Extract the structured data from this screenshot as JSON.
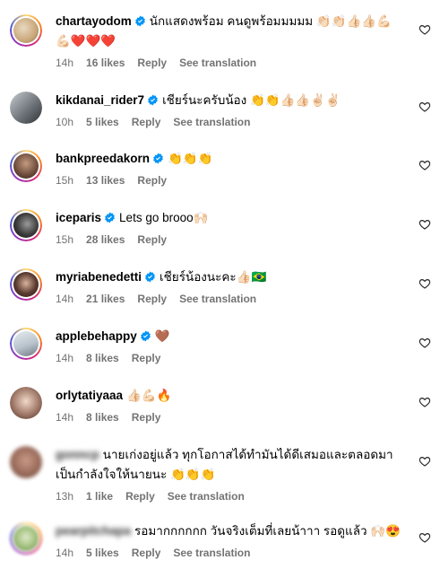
{
  "comments": [
    {
      "username": "chartayodom",
      "verified": true,
      "text": "นักแสดงพร้อม คนดูพร้อมมมมม 👏🏻👏🏻👍🏻👍🏻💪🏻",
      "text2": "💪🏻❤️❤️❤️",
      "time": "14h",
      "likes": "16 likes",
      "reply": "Reply",
      "translate": "See translation",
      "avatar_color": "#c9a77a"
    },
    {
      "username": "kikdanai_rider7",
      "verified": true,
      "text": "เชียร์นะครับน้อง 👏👏👍🏻👍🏻✌🏻✌🏻",
      "time": "10h",
      "likes": "5 likes",
      "reply": "Reply",
      "translate": "See translation",
      "avatar_color": "#8a8f94"
    },
    {
      "username": "bankpreedakorn",
      "verified": true,
      "text": "👏👏👏",
      "time": "15h",
      "likes": "13 likes",
      "reply": "Reply",
      "translate": "",
      "avatar_color": "#6b4a3a"
    },
    {
      "username": "iceparis",
      "verified": true,
      "text": "Lets go brooo🙌🏻",
      "time": "15h",
      "likes": "28 likes",
      "reply": "Reply",
      "translate": "",
      "avatar_color": "#3b3b3b"
    },
    {
      "username": "myriabenedetti",
      "verified": true,
      "text": "เชียร์น้องนะคะ👍🏻🇧🇷",
      "time": "14h",
      "likes": "21 likes",
      "reply": "Reply",
      "translate": "See translation",
      "avatar_color": "#5a3a30"
    },
    {
      "username": "applebehappy",
      "verified": true,
      "text": "🤎",
      "time": "14h",
      "likes": "8 likes",
      "reply": "Reply",
      "translate": "",
      "avatar_color": "#b9c3cc"
    },
    {
      "username": "orlytatiyaaa",
      "verified": false,
      "text": "👍🏻💪🏻🔥",
      "time": "14h",
      "likes": "8 likes",
      "reply": "Reply",
      "translate": "",
      "avatar_color": "#a07868"
    },
    {
      "username": "gonncp",
      "verified": false,
      "text": "นายเก่งอยู่แล้ว ทุกโอกาสได้ทำมันได้ดีเสมอและตลอดมา",
      "text2": "เป็นกำลังใจให้นายนะ 👏👏👏",
      "time": "13h",
      "likes": "1 like",
      "reply": "Reply",
      "translate": "See translation",
      "avatar_color": "#9a6b5a"
    },
    {
      "username": "pearpitchapa",
      "verified": false,
      "text": "รอมากกกกกก วันจริงเต็มที่เลยน้าาา รอดูแล้ว 🙌🏻😍",
      "time": "14h",
      "likes": "5 likes",
      "reply": "Reply",
      "translate": "See translation",
      "avatar_color": "#9fbf7a"
    }
  ],
  "colors": {
    "verified": "#0095f6",
    "meta": "#737373",
    "ring_accent": "#d62976"
  },
  "icons": {
    "like": "heart-outline-icon",
    "verified": "verified-badge-icon"
  }
}
